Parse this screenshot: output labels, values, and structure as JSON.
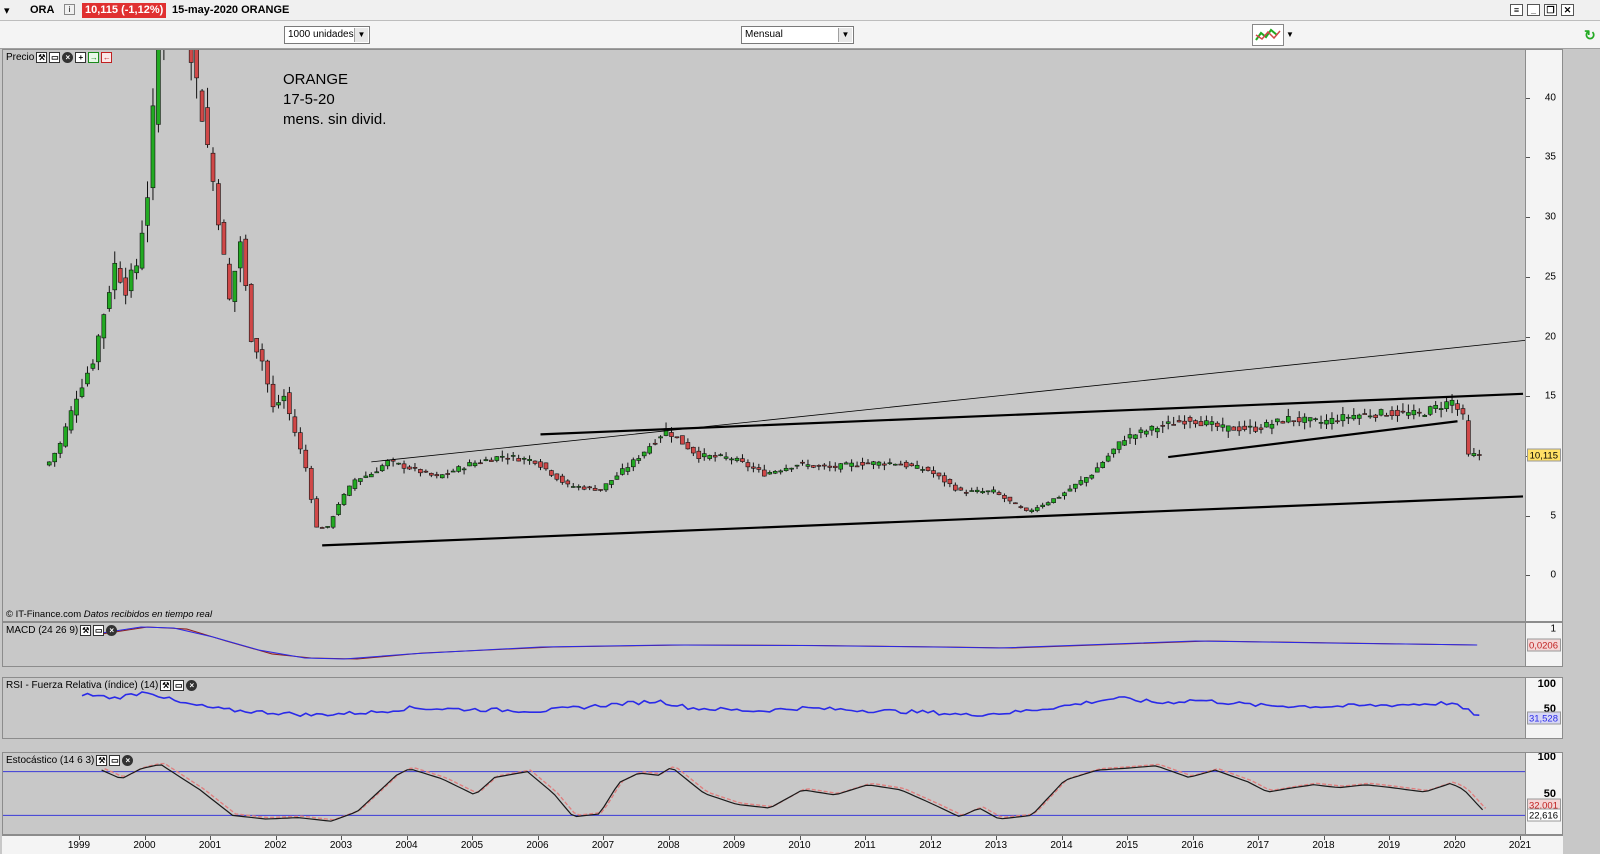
{
  "window": {
    "symbol": "ORA",
    "price_badge": "10,115 (-1,12%)",
    "date_title": "15-may-2020 ORANGE"
  },
  "toolbar": {
    "units_select": "1000 unidades",
    "period_select": "Mensual"
  },
  "price_panel": {
    "title": "Precio",
    "annotation": [
      "ORANGE",
      "17-5-20",
      "mens. sin divid."
    ],
    "credit_source": "© IT-Finance.com",
    "credit_note": "Datos recibidos en tiempo real",
    "last_value": "10,115",
    "y_ticks": [
      "40",
      "35",
      "30",
      "25",
      "20",
      "15",
      "10",
      "5",
      "0"
    ]
  },
  "macd_panel": {
    "title": "MACD (24 26 9)",
    "last_value": "0,0206",
    "y_ticks": [
      "1"
    ]
  },
  "rsi_panel": {
    "title": "RSI - Fuerza Relativa (índice) (14)",
    "last_value": "31,528",
    "y_ticks": [
      "100",
      "50"
    ]
  },
  "stoch_panel": {
    "title": "Estocástico (14 6 3)",
    "last_value_k": "32,001",
    "last_value_d": "22,616",
    "y_ticks": [
      "100",
      "50"
    ]
  },
  "x_axis": {
    "years": [
      "1999",
      "2000",
      "2001",
      "2002",
      "2003",
      "2004",
      "2005",
      "2006",
      "2007",
      "2008",
      "2009",
      "2010",
      "2011",
      "2012",
      "2013",
      "2014",
      "2015",
      "2016",
      "2017",
      "2018",
      "2019",
      "2020",
      "2021"
    ]
  },
  "colors": {
    "up_candle": "#22aa22",
    "down_candle": "#d04848",
    "rsi_line": "#2a2ae8",
    "stoch_k": "#1a1a1a",
    "stoch_d": "#e08080",
    "badge_red": "#e03030",
    "last_price_badge": "#ffe066"
  },
  "chart_data": [
    {
      "type": "candlestick",
      "title": "ORANGE",
      "ylim": [
        -4,
        44
      ],
      "x_range": [
        "1998-07",
        "2021-06"
      ],
      "grid": false,
      "monthly_close_approx": [
        {
          "x": "1998-07",
          "y": 9.5
        },
        {
          "x": "1998-09",
          "y": 11
        },
        {
          "x": "1998-12",
          "y": 15
        },
        {
          "x": "1999-03",
          "y": 18
        },
        {
          "x": "1999-05",
          "y": 22
        },
        {
          "x": "1999-07",
          "y": 26
        },
        {
          "x": "1999-09",
          "y": 24
        },
        {
          "x": "1999-11",
          "y": 26
        },
        {
          "x": "2000-01",
          "y": 32
        },
        {
          "x": "2000-03",
          "y": 45
        },
        {
          "x": "2000-06",
          "y": 50
        },
        {
          "x": "2000-09",
          "y": 44
        },
        {
          "x": "2000-12",
          "y": 36
        },
        {
          "x": "2001-02",
          "y": 30
        },
        {
          "x": "2001-04",
          "y": 23
        },
        {
          "x": "2001-06",
          "y": 28
        },
        {
          "x": "2001-08",
          "y": 20
        },
        {
          "x": "2001-10",
          "y": 18
        },
        {
          "x": "2001-12",
          "y": 14
        },
        {
          "x": "2002-02",
          "y": 15
        },
        {
          "x": "2002-04",
          "y": 12
        },
        {
          "x": "2002-06",
          "y": 9
        },
        {
          "x": "2002-08",
          "y": 4
        },
        {
          "x": "2002-10",
          "y": 4
        },
        {
          "x": "2002-12",
          "y": 6
        },
        {
          "x": "2003-03",
          "y": 8
        },
        {
          "x": "2003-06",
          "y": 8.5
        },
        {
          "x": "2003-09",
          "y": 9.5
        },
        {
          "x": "2004-01",
          "y": 9
        },
        {
          "x": "2004-06",
          "y": 8.2
        },
        {
          "x": "2004-12",
          "y": 9.3
        },
        {
          "x": "2005-06",
          "y": 10
        },
        {
          "x": "2005-12",
          "y": 9.6
        },
        {
          "x": "2006-06",
          "y": 7.5
        },
        {
          "x": "2006-12",
          "y": 7.2
        },
        {
          "x": "2007-06",
          "y": 9.5
        },
        {
          "x": "2007-12",
          "y": 12.2
        },
        {
          "x": "2008-06",
          "y": 10
        },
        {
          "x": "2008-12",
          "y": 9.8
        },
        {
          "x": "2009-06",
          "y": 8.5
        },
        {
          "x": "2009-12",
          "y": 9.3
        },
        {
          "x": "2010-06",
          "y": 9
        },
        {
          "x": "2010-12",
          "y": 9.4
        },
        {
          "x": "2011-06",
          "y": 9.4
        },
        {
          "x": "2011-12",
          "y": 8.8
        },
        {
          "x": "2012-06",
          "y": 7
        },
        {
          "x": "2012-12",
          "y": 7
        },
        {
          "x": "2013-06",
          "y": 5.3
        },
        {
          "x": "2013-12",
          "y": 6.6
        },
        {
          "x": "2014-06",
          "y": 8.5
        },
        {
          "x": "2014-12",
          "y": 11.5
        },
        {
          "x": "2015-06",
          "y": 12.4
        },
        {
          "x": "2015-12",
          "y": 13.1
        },
        {
          "x": "2016-06",
          "y": 12.3
        },
        {
          "x": "2016-12",
          "y": 12.3
        },
        {
          "x": "2017-06",
          "y": 13.1
        },
        {
          "x": "2017-12",
          "y": 12.8
        },
        {
          "x": "2018-06",
          "y": 13.4
        },
        {
          "x": "2018-12",
          "y": 13.6
        },
        {
          "x": "2019-06",
          "y": 13.5
        },
        {
          "x": "2019-12",
          "y": 14.6
        },
        {
          "x": "2020-02",
          "y": 13.2
        },
        {
          "x": "2020-03",
          "y": 10
        },
        {
          "x": "2020-05",
          "y": 10.115
        }
      ],
      "trendlines": [
        {
          "from": {
            "x": "2002-09",
            "y": 2.5
          },
          "to": {
            "x": "2021-01",
            "y": 6.6
          }
        },
        {
          "from": {
            "x": "2006-01",
            "y": 11.8
          },
          "to": {
            "x": "2021-01",
            "y": 15.2
          }
        },
        {
          "from": {
            "x": "2003-06",
            "y": 9.5
          },
          "to": {
            "x": "2021-06",
            "y": 19.9
          }
        },
        {
          "from": {
            "x": "2015-08",
            "y": 9.9
          },
          "to": {
            "x": "2020-01",
            "y": 12.9
          }
        }
      ]
    },
    {
      "type": "line",
      "title": "MACD (24 26 9)",
      "series": [
        {
          "name": "MACD (24 26 9)",
          "last": 0.0206
        }
      ]
    },
    {
      "type": "line",
      "title": "RSI - Fuerza Relativa (índice) (14)",
      "ylim": [
        0,
        100
      ],
      "series": [
        {
          "name": "RSI - Fuerza Relativa (índice) (14)",
          "last": 31.528
        }
      ]
    },
    {
      "type": "line",
      "title": "Estocástico (14 6 3)",
      "ylim": [
        0,
        100
      ],
      "series": [
        {
          "name": "Estocástico (14 6 3)",
          "last": 32.001
        },
        {
          "name": "Estocástico (14 6 3)",
          "last": 22.616
        }
      ]
    }
  ]
}
